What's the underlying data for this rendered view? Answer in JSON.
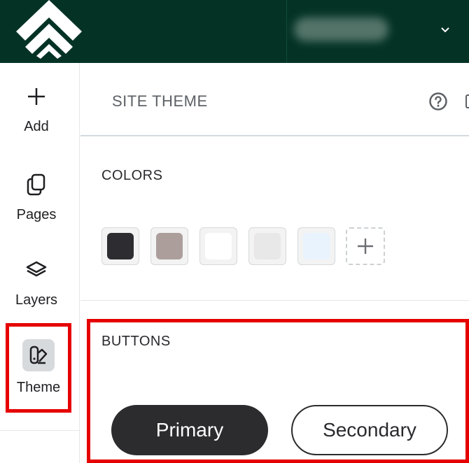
{
  "sidebar": {
    "items": [
      {
        "label": "Add",
        "icon": "plus-icon"
      },
      {
        "label": "Pages",
        "icon": "pages-icon"
      },
      {
        "label": "Layers",
        "icon": "layers-icon"
      },
      {
        "label": "Theme",
        "icon": "theme-icon",
        "active": true
      }
    ]
  },
  "panel": {
    "title": "SITE THEME",
    "colors": {
      "title": "COLORS",
      "swatches": [
        "#2d2d31",
        "#ac9f9b",
        "#ffffff",
        "#e8e8e8",
        "#e8f3fd"
      ]
    },
    "buttons": {
      "title": "BUTTONS",
      "primary_label": "Primary",
      "secondary_label": "Secondary"
    }
  },
  "theme": {
    "topbar_color": "#043326",
    "highlight_color": "#e60000"
  }
}
